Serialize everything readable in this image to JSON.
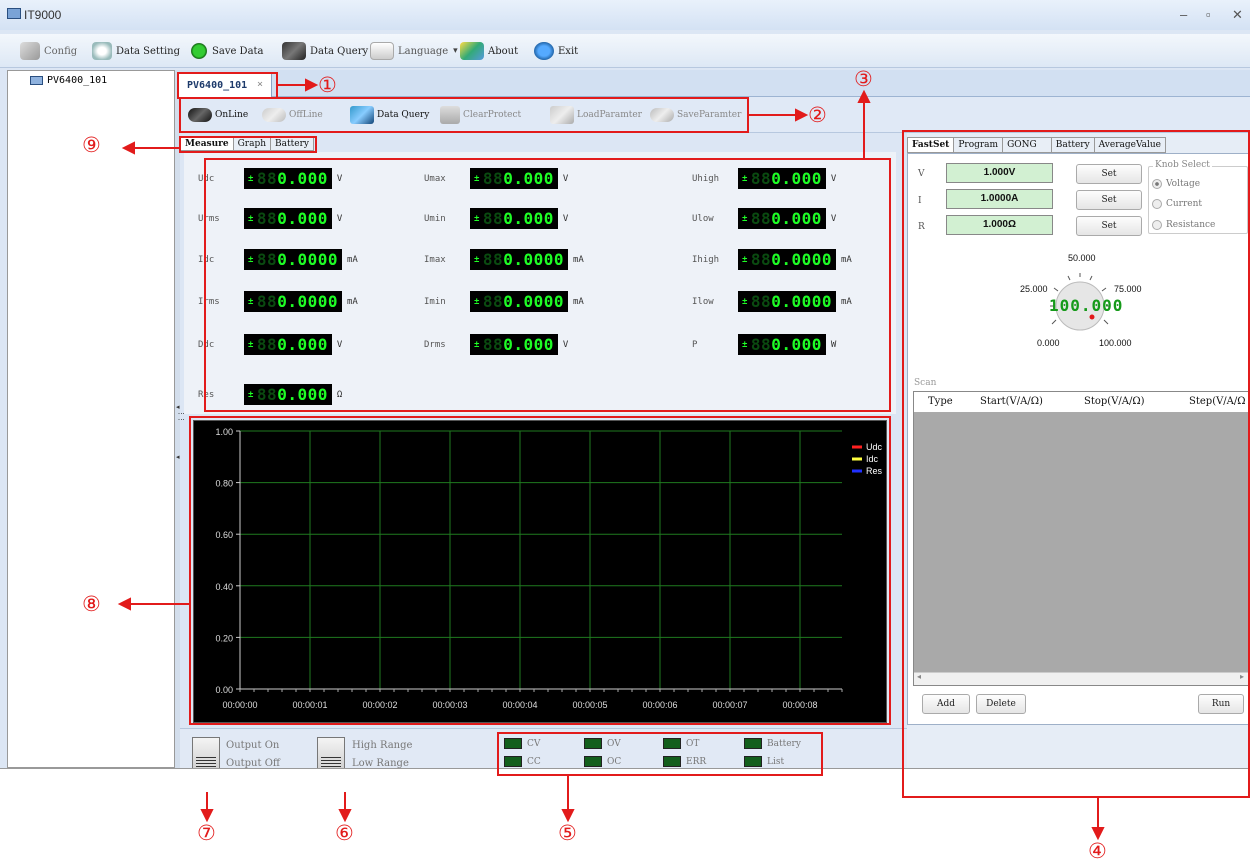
{
  "window": {
    "title": "IT9000",
    "controls": [
      "–",
      "▫",
      "✕"
    ]
  },
  "toolbar": {
    "config": "Config",
    "data_setting": "Data Setting",
    "save_data": "Save Data",
    "data_query": "Data Query",
    "language": "Language",
    "about": "About",
    "exit": "Exit"
  },
  "tree": {
    "device": "PV6400_101"
  },
  "doc_tab": {
    "label": "PV6400_101",
    "close": "×"
  },
  "commands": {
    "online": "OnLine",
    "offline": "OffLine",
    "data_query": "Data Query",
    "clear_protect": "ClearProtect",
    "load_parameter": "LoadParamter",
    "save_parameter": "SaveParamter"
  },
  "subtabs": [
    "Measure",
    "Graph",
    "Battery"
  ],
  "measure": [
    {
      "label": "Udc",
      "int": "0",
      "dec": "000",
      "unit": "V"
    },
    {
      "label": "Umax",
      "int": "0",
      "dec": "000",
      "unit": "V"
    },
    {
      "label": "Uhigh",
      "int": "0",
      "dec": "000",
      "unit": "V"
    },
    {
      "label": "Urms",
      "int": "0",
      "dec": "000",
      "unit": "V"
    },
    {
      "label": "Umin",
      "int": "0",
      "dec": "000",
      "unit": "V"
    },
    {
      "label": "Ulow",
      "int": "0",
      "dec": "000",
      "unit": "V"
    },
    {
      "label": "Idc",
      "int": "0",
      "dec": "0000",
      "unit": "mA"
    },
    {
      "label": "Imax",
      "int": "0",
      "dec": "0000",
      "unit": "mA"
    },
    {
      "label": "Ihigh",
      "int": "0",
      "dec": "0000",
      "unit": "mA"
    },
    {
      "label": "Irms",
      "int": "0",
      "dec": "0000",
      "unit": "mA"
    },
    {
      "label": "Imin",
      "int": "0",
      "dec": "0000",
      "unit": "mA"
    },
    {
      "label": "Ilow",
      "int": "0",
      "dec": "0000",
      "unit": "mA"
    },
    {
      "label": "Ddc",
      "int": "0",
      "dec": "000",
      "unit": "V"
    },
    {
      "label": "Drms",
      "int": "0",
      "dec": "000",
      "unit": "V"
    },
    {
      "label": "P",
      "int": "0",
      "dec": "000",
      "unit": "W"
    },
    {
      "label": "Res",
      "int": "0",
      "dec": "000",
      "unit": "Ω"
    }
  ],
  "graph": {
    "y_ticks": [
      "1.00",
      "0.80",
      "0.60",
      "0.40",
      "0.20",
      "0.00"
    ],
    "x_ticks": [
      "00:00:00",
      "00:00:01",
      "00:00:02",
      "00:00:03",
      "00:00:04",
      "00:00:05",
      "00:00:06",
      "00:00:07",
      "00:00:08"
    ],
    "legend": [
      {
        "name": "Udc",
        "color": "#ff2020"
      },
      {
        "name": "Idc",
        "color": "#ffff40"
      },
      {
        "name": "Res",
        "color": "#2030ff"
      }
    ],
    "grid_color": "#1f7a1f"
  },
  "switches": {
    "output_on": "Output On",
    "output_off": "Output Off",
    "high_range": "High Range",
    "low_range": "Low Range"
  },
  "leds": [
    "CV",
    "OV",
    "OT",
    "Battery",
    "CC",
    "OC",
    "ERR",
    "List"
  ],
  "right_tabs": [
    "FastSet",
    "Program",
    "GONG",
    "Battery",
    "AverageValue"
  ],
  "fastset": {
    "v_label": "V",
    "v_value": "1.000V",
    "i_label": "I",
    "i_value": "1.0000A",
    "r_label": "R",
    "r_value": "1.000Ω",
    "set": "Set",
    "knob_select_title": "Knob Select",
    "knob_options": [
      "Voltage",
      "Current",
      "Resistance"
    ],
    "knob_labels": {
      "top": "50.000",
      "left": "25.000",
      "right": "75.000",
      "bl": "0.000",
      "br": "100.000"
    },
    "knob_value": "100.000"
  },
  "scan": {
    "title": "Scan",
    "columns": [
      "Type",
      "Start(V/A/Ω)",
      "Stop(V/A/Ω)",
      "Step(V/A/Ω"
    ],
    "add": "Add",
    "delete": "Delete",
    "run": "Run"
  },
  "annotations": [
    "①",
    "②",
    "③",
    "④",
    "⑤",
    "⑥",
    "⑦",
    "⑧",
    "⑨"
  ],
  "colors": {
    "accent_red": "#e21b1b",
    "lcd_green": "#1efd25"
  }
}
